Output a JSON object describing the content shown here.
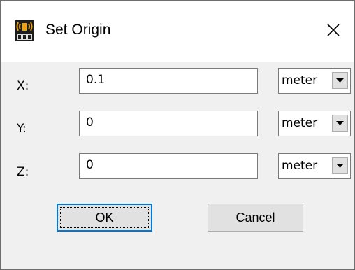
{
  "window": {
    "title": "Set Origin",
    "close_glyph": "✕"
  },
  "fields": [
    {
      "label": "X:",
      "value": "0.1",
      "unit": "meter"
    },
    {
      "label": "Y:",
      "value": "0",
      "unit": "meter"
    },
    {
      "label": "Z:",
      "value": "0",
      "unit": "meter"
    }
  ],
  "buttons": {
    "ok_label": "OK",
    "cancel_label": "Cancel"
  },
  "colors": {
    "focus_border": "#0078d7",
    "dialog_bg": "#f0f0f0"
  },
  "icons": {
    "app": "edt-app-icon",
    "close": "close-icon",
    "dropdown": "chevron-down-icon"
  }
}
